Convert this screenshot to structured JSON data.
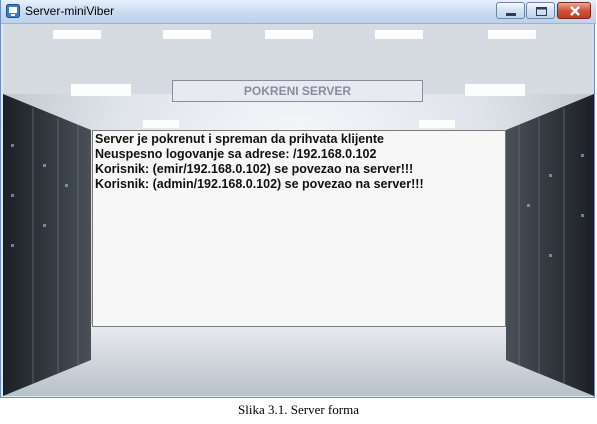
{
  "window": {
    "title": "Server-miniViber",
    "controls": {
      "minimize_icon": "minimize-icon",
      "maximize_icon": "maximize-icon",
      "close_icon": "close-icon"
    }
  },
  "main": {
    "start_button_label": "POKRENI SERVER",
    "log_lines": [
      "Server je pokrenut i spreman da prihvata klijente",
      "Neuspesno logovanje sa adrese: /192.168.0.102",
      "Korisnik: (emir/192.168.0.102) se povezao na server!!!",
      "Korisnik: (admin/192.168.0.102) se povezao na server!!!"
    ]
  },
  "caption": "Slika 3.1. Server forma",
  "colors": {
    "titlebar": "#c8daf0",
    "close_button": "#d0533b",
    "log_background": "#f7f7f7",
    "button_text": "#8a8aa0"
  }
}
